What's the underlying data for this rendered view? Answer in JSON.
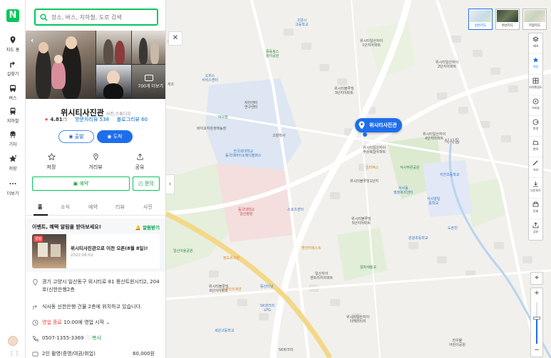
{
  "rail": {
    "items": [
      {
        "label": "지도 홈",
        "icon": "pin-icon"
      },
      {
        "label": "길찾기",
        "icon": "directions-icon"
      },
      {
        "label": "버스",
        "icon": "bus-icon"
      },
      {
        "label": "지하철",
        "icon": "subway-icon"
      },
      {
        "label": "기차",
        "icon": "train-icon"
      },
      {
        "label": "저장",
        "icon": "star-icon"
      },
      {
        "label": "더보기",
        "icon": "more-icon"
      }
    ]
  },
  "search": {
    "placeholder": "장소, 버스, 지하철, 도로 검색"
  },
  "place": {
    "photo_count": "700개 더보기",
    "name": "위시티사진관",
    "category": "사진,스튜디오",
    "rating": "4.81",
    "rating_max": "/5",
    "visitor_reviews": "방문자리뷰 538",
    "blog_reviews": "블로그리뷰 60",
    "start_label": "출발",
    "arrive_label": "도착",
    "actions": [
      {
        "label": "저장",
        "icon": "star-outline-icon"
      },
      {
        "label": "거리뷰",
        "icon": "streetview-icon"
      },
      {
        "label": "공유",
        "icon": "share-icon"
      }
    ],
    "book_label": "예약",
    "ask_label": "문의",
    "tabs": [
      "홈",
      "소식",
      "예약",
      "리뷰",
      "사진"
    ],
    "events_heading": "이벤트, 혜택 알림을 받아보세요!",
    "events_alert": "알림받기",
    "event": {
      "badge": "알림",
      "title": "위시티사진관으로 이전 오픈(8월 8일)!",
      "date": "2022.08.02."
    },
    "address": "경기 고양시 일산동구 위시티로 81 풍산트윈시티2, 204호(신한은행2층",
    "directions_note": "식사동 신한은행 건물 2층에 위치하고 있습니다.",
    "status": "영업 종료",
    "hours": "10:00에 영업 시작",
    "phone": "0507-1355-3369",
    "copy_label": "복사",
    "extra_row": "2인 촬영(증명/여권/취업)",
    "extra_price": "60,000원"
  },
  "map": {
    "pin_label": "위시티사진관",
    "area_label": "식사동",
    "map_types": [
      "일반지도",
      "위성지도",
      "지형지도"
    ],
    "tools": [
      "테마",
      "저장",
      "지적편집도",
      "거리뷰",
      "반경",
      "면적",
      "거리",
      "다운로드",
      "인쇄",
      "공유"
    ],
    "labels": [
      {
        "t": "고양시\n고등학교",
        "c": "blue"
      },
      {
        "t": "위시티일산자이\n1단지아파트",
        "c": ""
      },
      {
        "t": "풍동복스\n놀이공원",
        "c": "green"
      },
      {
        "t": "오피스\n서비스센터",
        "c": "blue"
      },
      {
        "t": "위시티블루밍\n3단지아파트",
        "c": ""
      },
      {
        "t": "위시티일산자이\n2단지아파트",
        "c": ""
      },
      {
        "t": "자한센터\n연구센터",
        "c": ""
      },
      {
        "t": "아구장",
        "c": "green"
      },
      {
        "t": "바이오자원생태농장",
        "c": ""
      },
      {
        "t": "고양학사",
        "c": ""
      },
      {
        "t": "위시티일산자이\n주상복합아파트",
        "c": ""
      },
      {
        "t": "위시티일산자이\n4단지아파트",
        "c": ""
      },
      {
        "t": "한국외대학교\n동국대바이오메디캠퍼스",
        "c": "blue"
      },
      {
        "t": "식사푸른공원",
        "c": "green"
      },
      {
        "t": "스타벅스",
        "c": "orange"
      },
      {
        "t": "지한초등학교",
        "c": "blue"
      },
      {
        "t": "위시티블루밍1단지",
        "c": ""
      },
      {
        "t": "식사동\n행정복지센터",
        "c": "blue"
      },
      {
        "t": "동국대학교\n일산병원",
        "c": "red"
      },
      {
        "t": "스포츠센터",
        "c": "blue"
      },
      {
        "t": "식사양일\n중학교",
        "c": "blue"
      },
      {
        "t": "위시티블루밍\n5단지아파트",
        "c": ""
      },
      {
        "t": "도촌천",
        "c": "blue"
      },
      {
        "t": "원광초등학교",
        "c": "blue"
      },
      {
        "t": "일산아울공원",
        "c": "green"
      },
      {
        "t": "맨인터레스트",
        "c": "orange"
      },
      {
        "t": "정도유치원",
        "c": "orange"
      },
      {
        "t": "위시티블루밍\n6단지아파트",
        "c": ""
      },
      {
        "t": "알파새울교",
        "c": "green"
      },
      {
        "t": "일산자이\n센트리지아파트",
        "c": ""
      },
      {
        "t": "양실리즈애견",
        "c": "orange"
      },
      {
        "t": "풍산터널",
        "c": "blue"
      },
      {
        "t": "SK엔크리\nLPG",
        "c": "blue"
      },
      {
        "t": "위시티일산자이\n더헤리티지",
        "c": ""
      },
      {
        "t": "세원고등학교",
        "c": "blue"
      },
      {
        "t": "5K바크리",
        "c": ""
      },
      {
        "t": "한우물\n어린이공원",
        "c": ""
      }
    ]
  }
}
